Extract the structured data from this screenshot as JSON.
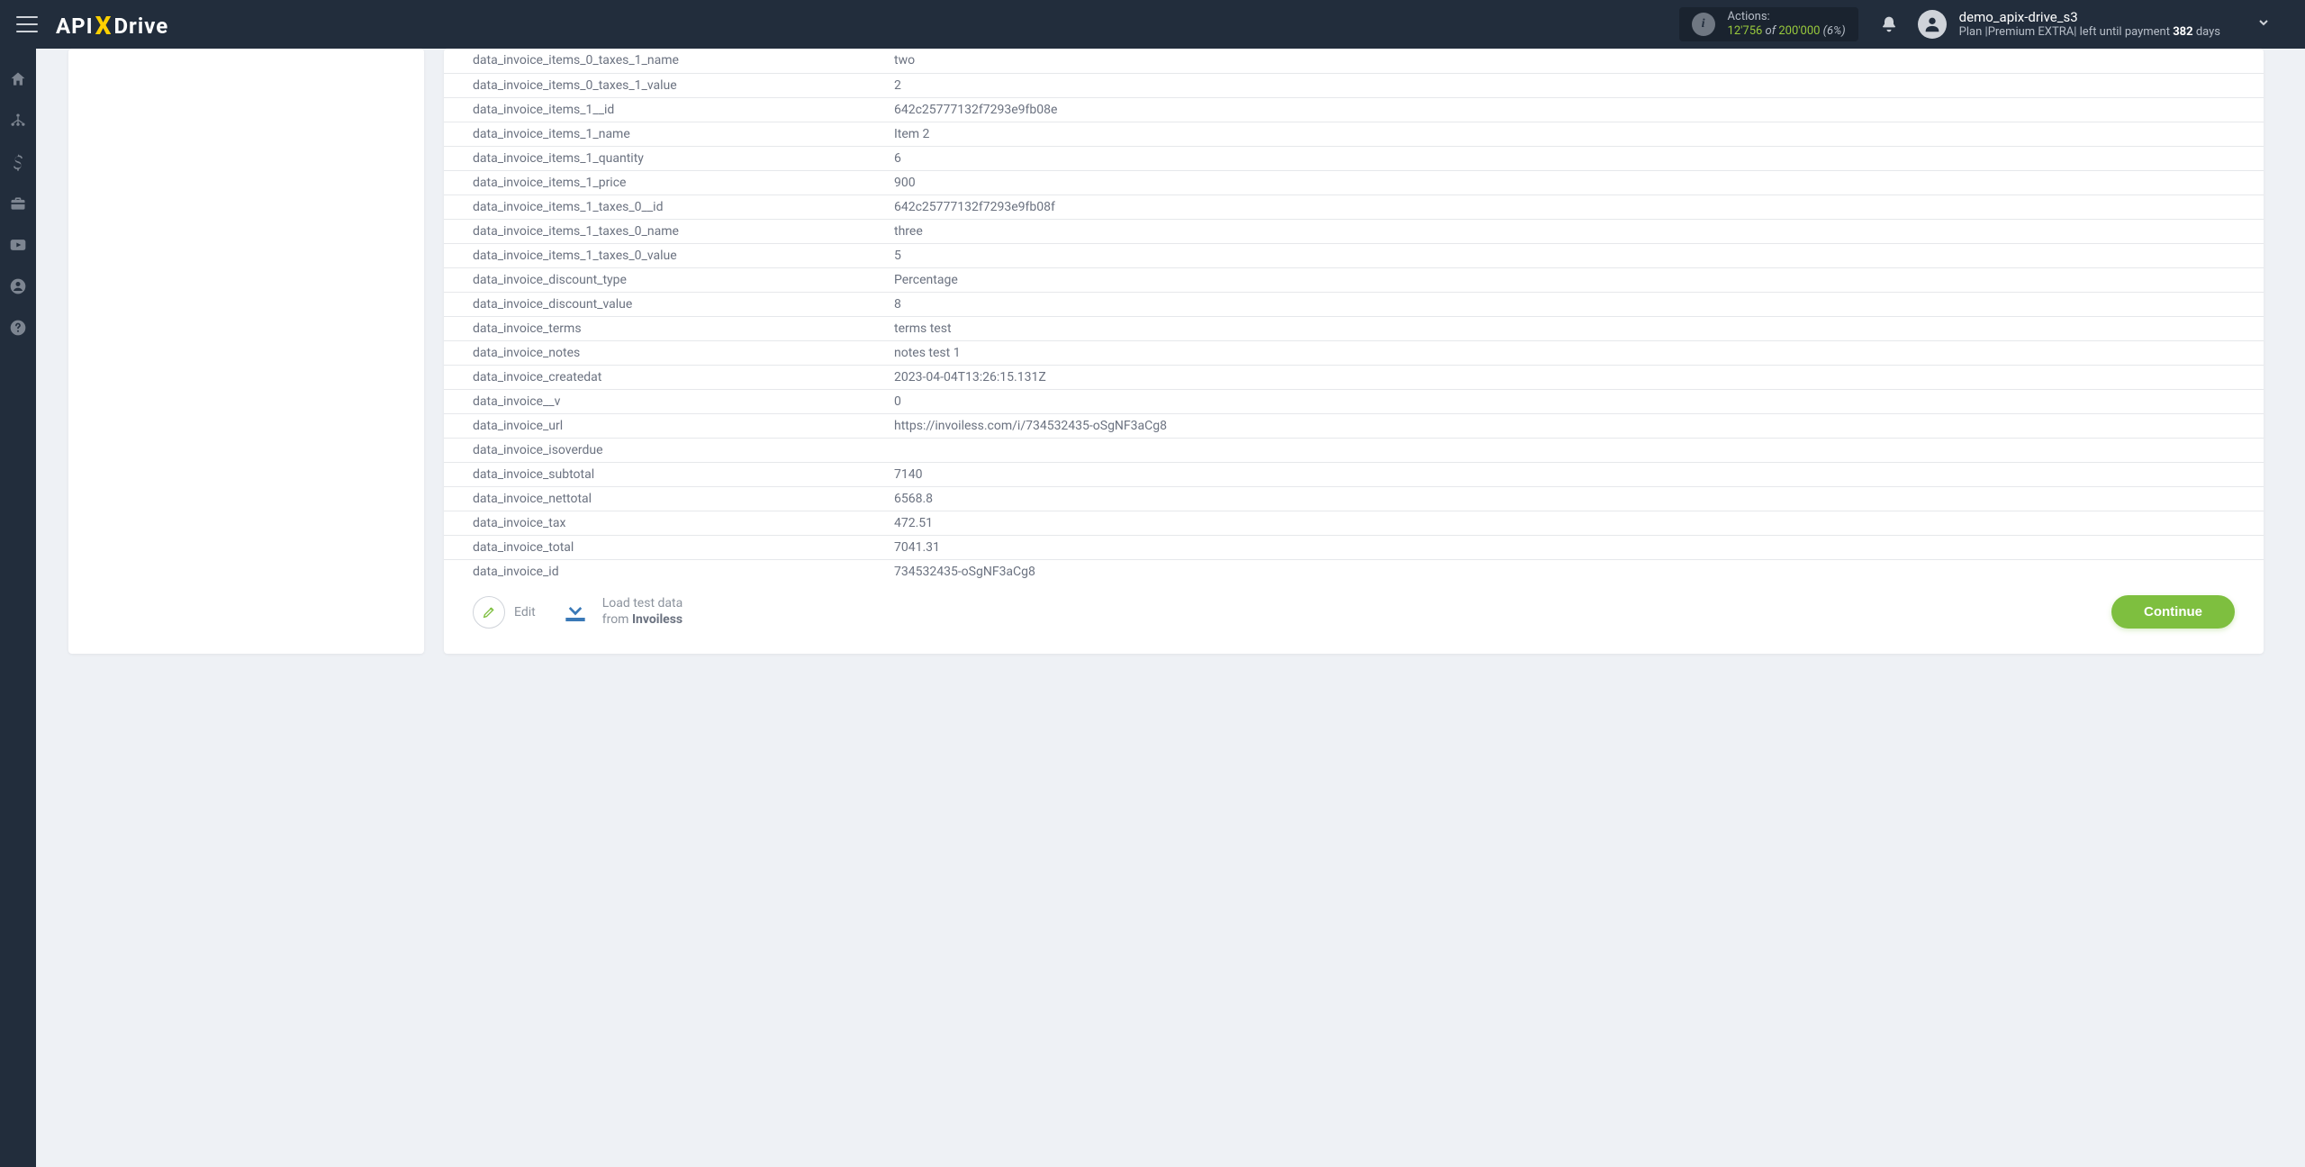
{
  "topbar": {
    "logo_api": "API",
    "logo_x": "X",
    "logo_drive": "Drive",
    "actions_label": "Actions:",
    "actions_used": "12'756",
    "actions_of": " of ",
    "actions_total": "200'000",
    "actions_pct": " (6%)",
    "user_name": "demo_apix-drive_s3",
    "plan_prefix": "Plan  |",
    "plan_name": "Premium EXTRA",
    "plan_mid": "|  left until payment ",
    "plan_days": "382",
    "plan_suffix": " days"
  },
  "rows": [
    {
      "k": "data_invoice_items_0_taxes_1_name",
      "v": "two"
    },
    {
      "k": "data_invoice_items_0_taxes_1_value",
      "v": "2"
    },
    {
      "k": "data_invoice_items_1__id",
      "v": "642c25777132f7293e9fb08e"
    },
    {
      "k": "data_invoice_items_1_name",
      "v": "Item 2"
    },
    {
      "k": "data_invoice_items_1_quantity",
      "v": "6"
    },
    {
      "k": "data_invoice_items_1_price",
      "v": "900"
    },
    {
      "k": "data_invoice_items_1_taxes_0__id",
      "v": "642c25777132f7293e9fb08f"
    },
    {
      "k": "data_invoice_items_1_taxes_0_name",
      "v": "three"
    },
    {
      "k": "data_invoice_items_1_taxes_0_value",
      "v": "5"
    },
    {
      "k": "data_invoice_discount_type",
      "v": "Percentage"
    },
    {
      "k": "data_invoice_discount_value",
      "v": "8"
    },
    {
      "k": "data_invoice_terms",
      "v": "terms test"
    },
    {
      "k": "data_invoice_notes",
      "v": "notes test 1"
    },
    {
      "k": "data_invoice_createdat",
      "v": "2023-04-04T13:26:15.131Z"
    },
    {
      "k": "data_invoice__v",
      "v": "0"
    },
    {
      "k": "data_invoice_url",
      "v": "https://invoiless.com/i/734532435-oSgNF3aCg8"
    },
    {
      "k": "data_invoice_isoverdue",
      "v": ""
    },
    {
      "k": "data_invoice_subtotal",
      "v": "7140"
    },
    {
      "k": "data_invoice_nettotal",
      "v": "6568.8"
    },
    {
      "k": "data_invoice_tax",
      "v": "472.51"
    },
    {
      "k": "data_invoice_total",
      "v": "7041.31"
    },
    {
      "k": "data_invoice_id",
      "v": "734532435-oSgNF3aCg8"
    }
  ],
  "footer": {
    "edit": "Edit",
    "load_line1": "Load test data",
    "load_from": "from ",
    "load_src": "Invoiless",
    "continue": "Continue"
  }
}
